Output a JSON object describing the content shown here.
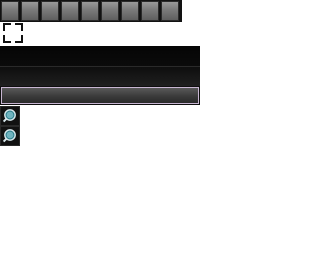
{
  "toolbar": {
    "tiles": [
      "tile",
      "tile",
      "tile",
      "tile",
      "tile",
      "tile",
      "tile",
      "tile",
      "tile"
    ]
  },
  "icons": {
    "fullscreen": "fullscreen-icon",
    "zoom_in": "zoom-in-icon",
    "zoom_out": "zoom-out-icon"
  },
  "colors": {
    "bar_selected_border": "#c8b6d2"
  }
}
